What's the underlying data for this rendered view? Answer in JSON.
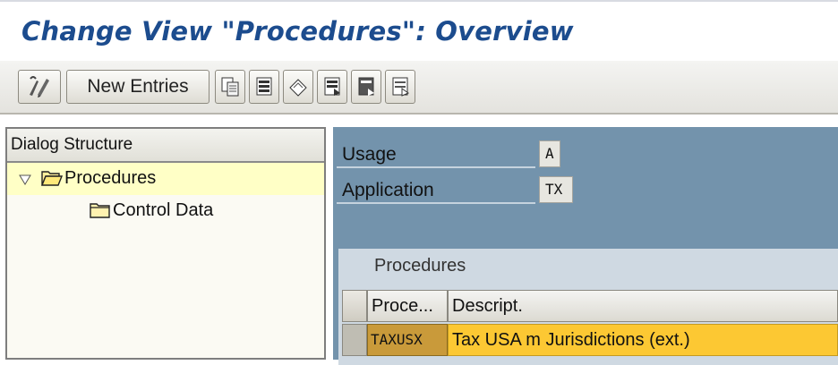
{
  "window": {
    "title": "Change View \"Procedures\": Overview"
  },
  "toolbar": {
    "buttons": [
      {
        "icon": "display-change-icon",
        "label": ""
      },
      {
        "icon": "",
        "label": "New Entries"
      },
      {
        "icon": "copy-icon",
        "label": ""
      },
      {
        "icon": "delete-icon",
        "label": ""
      },
      {
        "icon": "undo-change-icon",
        "label": ""
      },
      {
        "icon": "select-all-icon",
        "label": ""
      },
      {
        "icon": "select-block-icon",
        "label": ""
      },
      {
        "icon": "deselect-all-icon",
        "label": ""
      }
    ],
    "new_entries_label": "New Entries"
  },
  "dialog_structure": {
    "header": "Dialog Structure",
    "items": [
      {
        "label": "Procedures",
        "icon": "open-folder-icon",
        "expanded": true,
        "selected": true
      },
      {
        "label": "Control Data",
        "icon": "folder-icon",
        "expanded": false,
        "selected": false
      }
    ]
  },
  "fields": {
    "usage": {
      "label": "Usage",
      "value": "A"
    },
    "application": {
      "label": "Application",
      "value": "TX"
    }
  },
  "procedures_table": {
    "title": "Procedures",
    "columns": [
      "Proce...",
      "Descript."
    ],
    "rows": [
      {
        "procedure": "TAXUSX",
        "description": "Tax USA m Jurisdictions (ext.)"
      }
    ]
  },
  "colors": {
    "title": "#1c4c8e",
    "right_panel": "#7393ac",
    "selected_row_desc": "#fcc833",
    "selected_row_key": "#c99a3a",
    "tree_selected": "#ffffc6"
  }
}
